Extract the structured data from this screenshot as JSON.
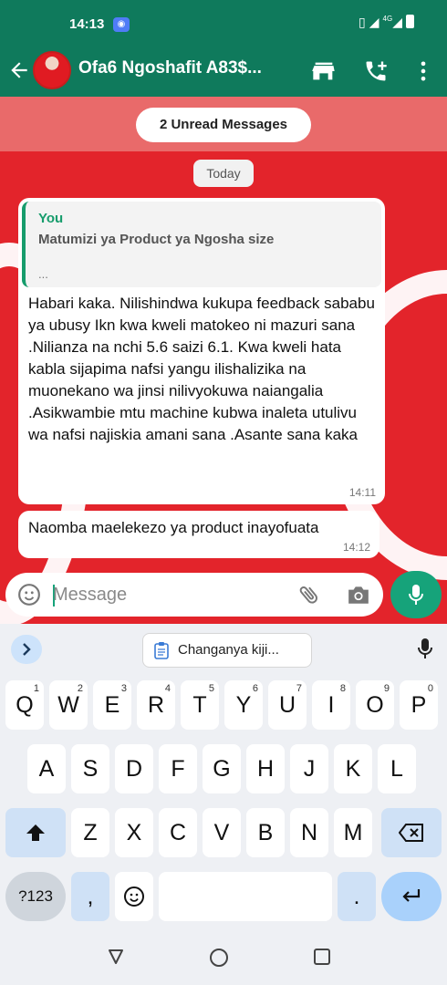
{
  "status": {
    "time": "14:13",
    "network": "4G"
  },
  "header": {
    "contact_name": "Ofa6 Ngoshafit A83$..."
  },
  "chat": {
    "unread_label": "2 Unread Messages",
    "date_label": "Today",
    "messages": [
      {
        "quote_author": "You",
        "quote_title": "Matumizi ya Product ya Ngosha size",
        "quote_ellipsis": "...",
        "text": "Habari kaka. Nilishindwa kukupa feedback sababu ya ubusy Ikn kwa kweli matokeo ni mazuri sana .Nilianza na nchi 5.6 saizi 6.1. Kwa kweli hata kabla sijapima nafsi yangu ilishalizika na muonekano wa jinsi nilivyokuwa naiangalia .Asikwambie mtu machine kubwa inaleta utulivu wa nafsi najiskia amani sana .Asante sana kaka",
        "time": "14:11"
      },
      {
        "text": "Naomba maelekezo ya product inayofuata",
        "time": "14:12"
      }
    ]
  },
  "composer": {
    "placeholder": "Message",
    "value": ""
  },
  "keyboard": {
    "suggestion_chip": "Changanya kiji...",
    "row1": [
      {
        "k": "Q",
        "h": "1"
      },
      {
        "k": "W",
        "h": "2"
      },
      {
        "k": "E",
        "h": "3"
      },
      {
        "k": "R",
        "h": "4"
      },
      {
        "k": "T",
        "h": "5"
      },
      {
        "k": "Y",
        "h": "6"
      },
      {
        "k": "U",
        "h": "7"
      },
      {
        "k": "I",
        "h": "8"
      },
      {
        "k": "O",
        "h": "9"
      },
      {
        "k": "P",
        "h": "0"
      }
    ],
    "row2": [
      "A",
      "S",
      "D",
      "F",
      "G",
      "H",
      "J",
      "K",
      "L"
    ],
    "row3": [
      "Z",
      "X",
      "C",
      "V",
      "B",
      "N",
      "M"
    ],
    "symbols_label": "?123",
    "comma_label": ",",
    "period_label": "."
  },
  "colors": {
    "header": "#0f7a5c",
    "accent": "#16a37a",
    "wallpaper": "#e3242b"
  }
}
